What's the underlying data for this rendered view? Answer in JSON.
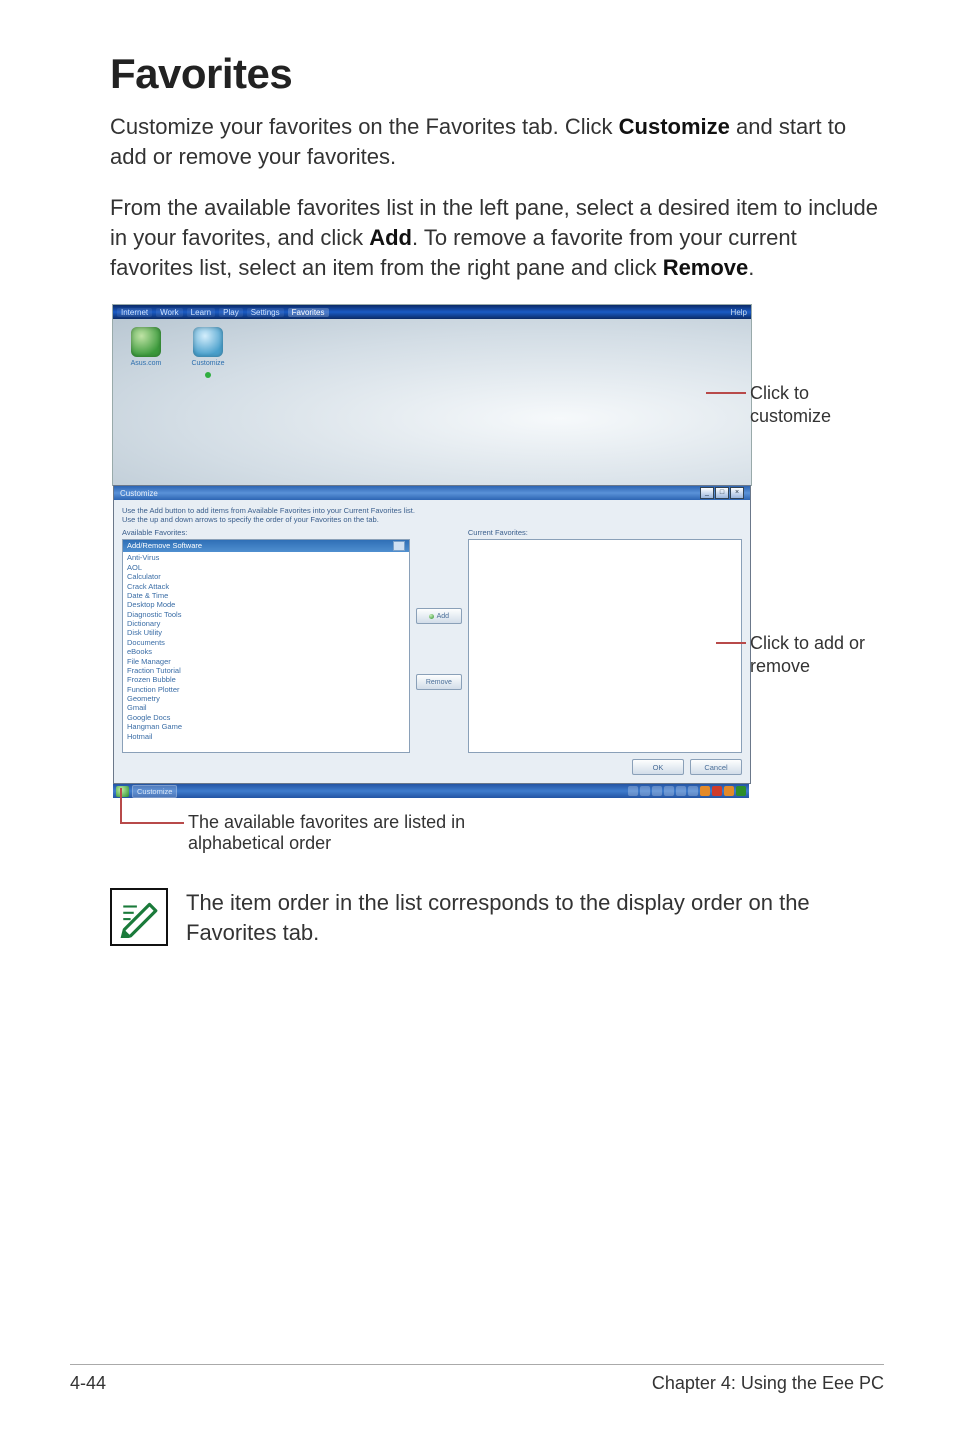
{
  "page": {
    "title": "Favorites",
    "para1_pre": "Customize your favorites on the Favorites tab. Click ",
    "para1_bold": "Customize",
    "para1_post": " and start to add or remove your favorites.",
    "para2_a": "From the available favorites list in the left pane, select a desired item to include in your favorites, and click ",
    "para2_b1": "Add",
    "para2_mid": ". To remove a favorite from your current favorites list, select an item from the right pane and click ",
    "para2_b2": "Remove",
    "para2_end": "."
  },
  "callouts": {
    "customize": "Click to customize",
    "addremove_l1": "Click to add or",
    "addremove_l2": "remove",
    "caption_l1": "The available favorites are listed in",
    "caption_l2": "alphabetical order"
  },
  "note": {
    "text": "The item order in the list corresponds to the display order on the Favorites tab."
  },
  "footer": {
    "left": "4-44",
    "right": "Chapter 4: Using the Eee PC"
  },
  "app": {
    "tabs": [
      "Internet",
      "Work",
      "Learn",
      "Play",
      "Settings",
      "Favorites"
    ],
    "active_tab_index": 5,
    "help": "Help",
    "icon1_label": "Asus.com",
    "icon2_label": "Customize"
  },
  "dialog": {
    "title": "Customize",
    "hint1": "Use the Add button to add items from Available Favorites into your Current Favorites list.",
    "hint2": "Use the up and down arrows to specify the order of your Favorites on the tab.",
    "left_label": "Available Favorites:",
    "right_label": "Current Favorites:",
    "left_header": "Add/Remove Software",
    "items": [
      "Anti-Virus",
      "AOL",
      "Calculator",
      "Crack Attack",
      "Date & Time",
      "Desktop Mode",
      "Diagnostic Tools",
      "Dictionary",
      "Disk Utility",
      "Documents",
      "eBooks",
      "File Manager",
      "Fraction Tutorial",
      "Frozen Bubble",
      "Function Plotter",
      "Geometry",
      "Gmail",
      "Google Docs",
      "Hangman Game",
      "Hotmail"
    ],
    "add_btn": "Add",
    "remove_btn": "Remove",
    "ok": "OK",
    "cancel": "Cancel"
  },
  "taskbar": {
    "task": "Customize",
    "tray_icons": 10
  }
}
